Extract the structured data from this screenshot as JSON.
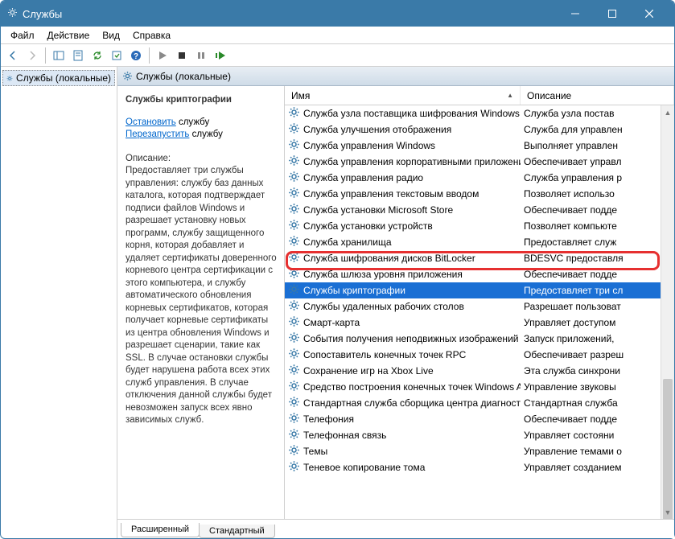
{
  "window": {
    "title": "Службы"
  },
  "menu": {
    "file": "Файл",
    "action": "Действие",
    "view": "Вид",
    "help": "Справка"
  },
  "tree": {
    "root": "Службы (локальные)"
  },
  "main_header": "Службы (локальные)",
  "columns": {
    "name": "Имя",
    "desc": "Описание"
  },
  "detail": {
    "name": "Службы криптографии",
    "stop_link": "Остановить",
    "stop_tail": " службу",
    "restart_link": "Перезапустить",
    "restart_tail": " службу",
    "desc_label": "Описание:",
    "desc_text": "Предоставляет три службы управления: службу баз данных каталога, которая подтверждает подписи файлов Windows и разрешает установку новых программ, службу защищенного корня, которая добавляет и удаляет сертификаты доверенного корневого центра сертификации с этого компьютера, и службу автоматического обновления корневых сертификатов, которая получает корневые сертификаты из центра обновления Windows и разрешает сценарии, такие как SSL. В случае остановки службы будет нарушена работа всех этих служб управления. В случае отключения данной службы будет невозможен запуск всех явно зависимых служб."
  },
  "services": [
    {
      "name": "Служба узла поставщика шифрования Windows",
      "desc": "Служба узла постав"
    },
    {
      "name": "Служба улучшения отображения",
      "desc": "Служба для управлен"
    },
    {
      "name": "Служба управления Windows",
      "desc": "Выполняет управлен"
    },
    {
      "name": "Служба управления корпоративными приложения...",
      "desc": "Обеспечивает управл"
    },
    {
      "name": "Служба управления радио",
      "desc": "Служба управления р"
    },
    {
      "name": "Служба управления текстовым вводом",
      "desc": "Позволяет использо"
    },
    {
      "name": "Служба установки Microsoft Store",
      "desc": "Обеспечивает подде"
    },
    {
      "name": "Служба установки устройств",
      "desc": "Позволяет компьюте"
    },
    {
      "name": "Служба хранилища",
      "desc": "Предоставляет служ"
    },
    {
      "name": "Служба шифрования дисков BitLocker",
      "desc": "BDESVC предоставля"
    },
    {
      "name": "Служба шлюза уровня приложения",
      "desc": "Обеспечивает подде"
    },
    {
      "name": "Службы криптографии",
      "desc": "Предоставляет три сл",
      "selected": true
    },
    {
      "name": "Службы удаленных рабочих столов",
      "desc": "Разрешает пользоват"
    },
    {
      "name": "Смарт-карта",
      "desc": "Управляет доступом"
    },
    {
      "name": "События получения неподвижных изображений",
      "desc": "Запуск приложений,"
    },
    {
      "name": "Сопоставитель конечных точек RPC",
      "desc": "Обеспечивает разреш"
    },
    {
      "name": "Сохранение игр на Xbox Live",
      "desc": "Эта служба синхрони"
    },
    {
      "name": "Средство построения конечных точек Windows Audio",
      "desc": "Управление звуковы"
    },
    {
      "name": "Стандартная служба сборщика центра диагностики...",
      "desc": "Стандартная служба"
    },
    {
      "name": "Телефония",
      "desc": "Обеспечивает подде"
    },
    {
      "name": "Телефонная связь",
      "desc": "Управляет состояни"
    },
    {
      "name": "Темы",
      "desc": "Управление темами о"
    },
    {
      "name": "Теневое копирование тома",
      "desc": "Управляет созданием"
    }
  ],
  "tabs": {
    "extended": "Расширенный",
    "standard": "Стандартный"
  }
}
